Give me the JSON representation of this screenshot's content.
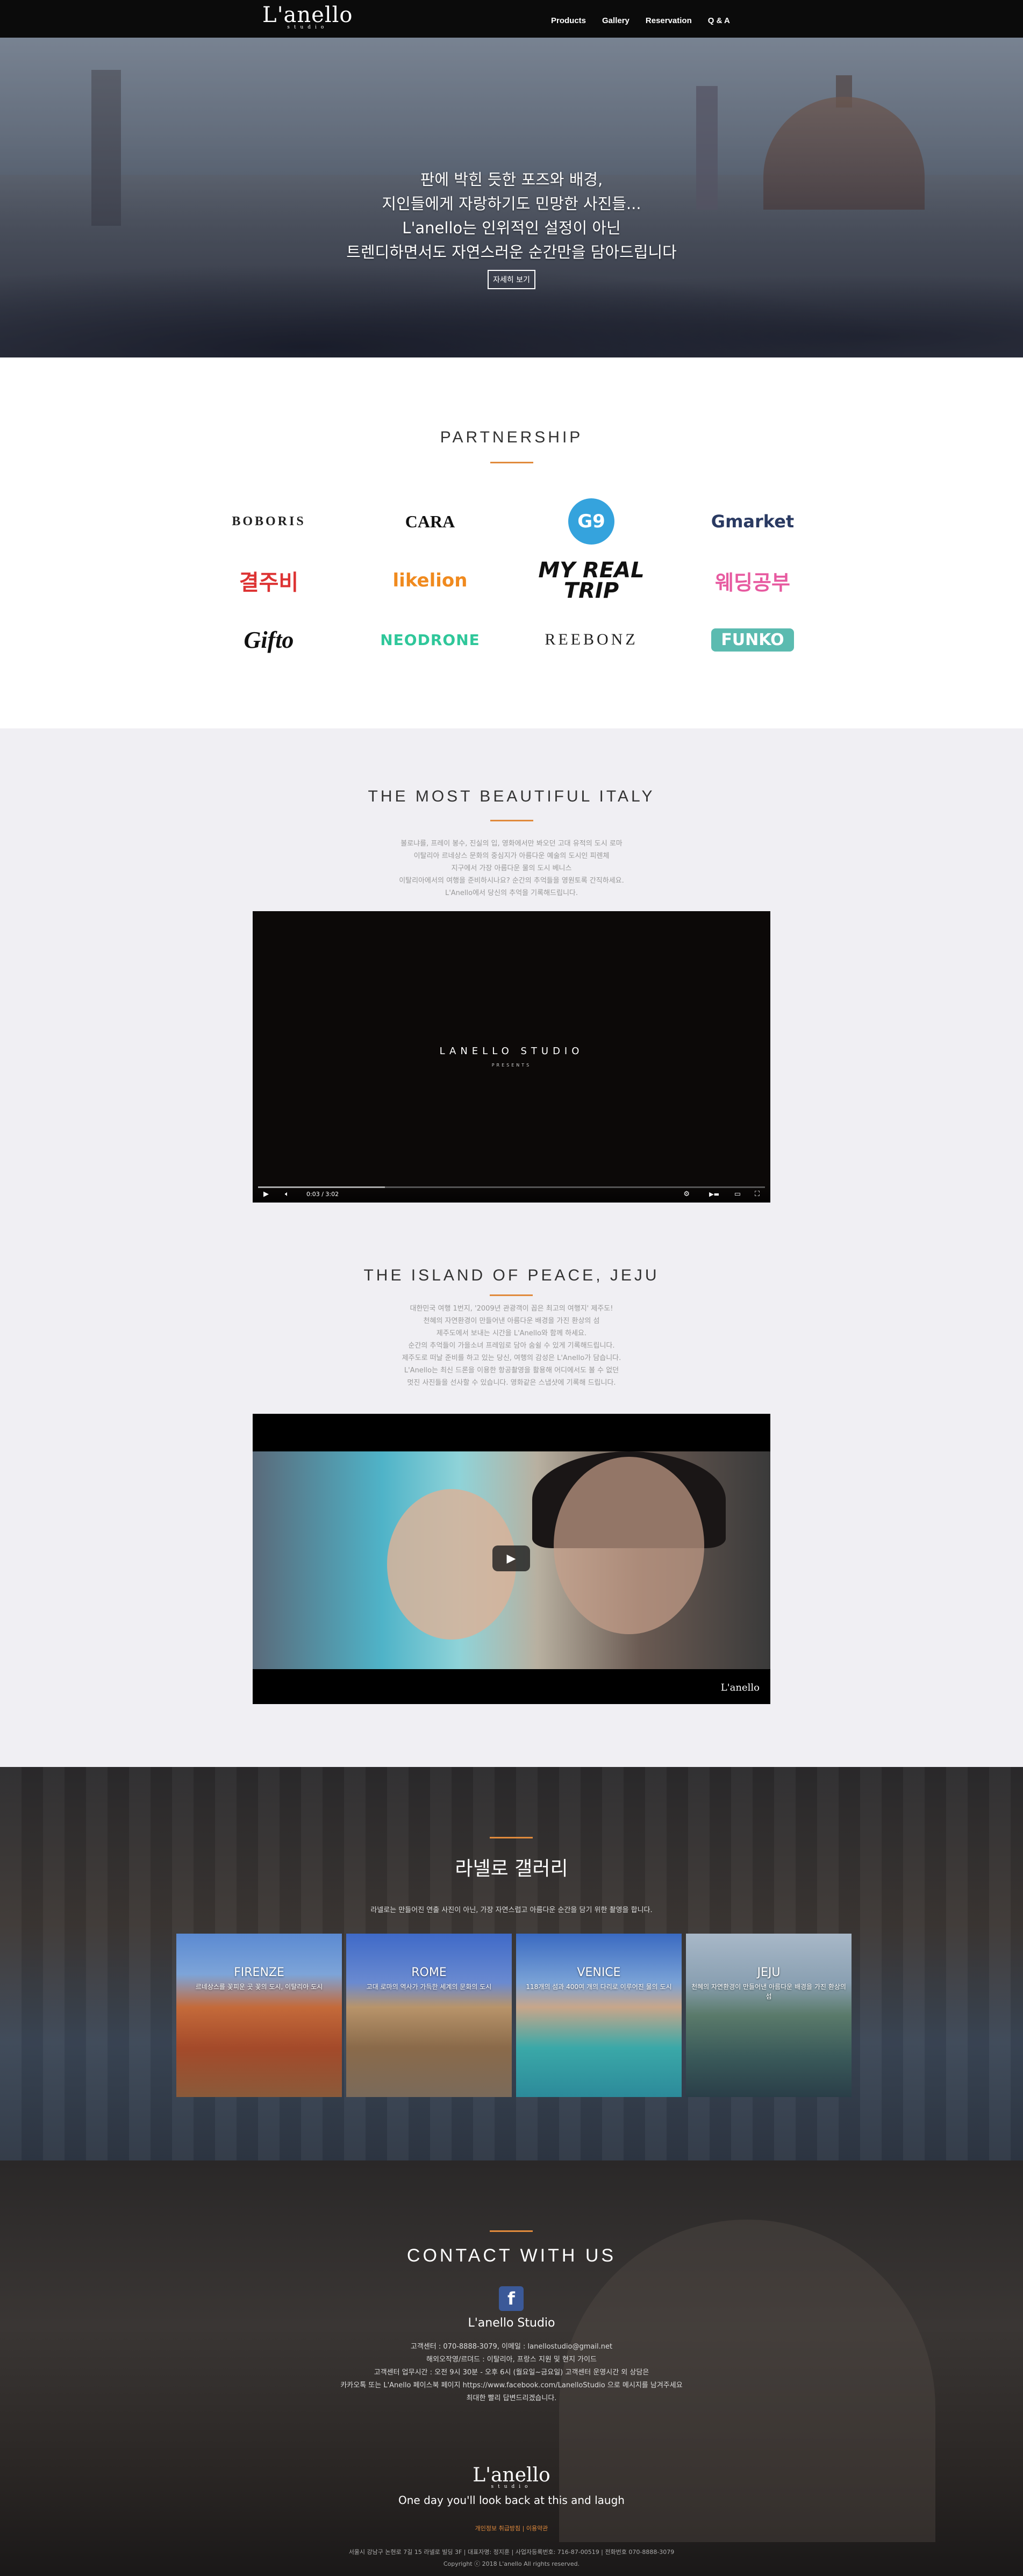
{
  "brand": {
    "logo": "L'anello",
    "sub": "studio"
  },
  "nav": {
    "items": [
      "Products",
      "Gallery",
      "Reservation",
      "Q & A"
    ]
  },
  "hero": {
    "lines": [
      "판에 박힌 듯한 포즈와 배경,",
      "지인들에게 자랑하기도 민망한 사진들...",
      "L'anello는 인위적인 설정이 아닌",
      "트렌디하면서도 자연스러운 순간만을 담아드립니다"
    ],
    "button": "자세히 보기"
  },
  "partnership": {
    "title": "PARTNERSHIP",
    "logos": [
      "BOBORIS",
      "CARA",
      "G9",
      "Gmarket",
      "결주비",
      "likelion",
      "MY REAL TRIP",
      "웨딩공부",
      "Gifto",
      "NEODRONE",
      "REEBONZ",
      "FUNKO"
    ]
  },
  "italy": {
    "title": "THE MOST BEAUTIFUL ITALY",
    "desc": [
      "볼로냐를, 프레이 봉수, 진실의 입, 영화에서만 봐오던 고대 유적의 도시 로마",
      "이탈리아 르네상스 문화의 중심지가 아름다운 예술의 도시인 피렌체",
      "지구에서 가장 아름다운 물의 도시 베니스",
      "이탈리아에서의 여행을 준비하시나요? 순간의 추억들을 영원토록 간직하세요.",
      "L'Anello에서 당신의 추억을 기록해드립니다."
    ],
    "video": {
      "title": "LANELLO STUDIO",
      "subtitle": "PRESENTS",
      "time": "0:03 / 3:02",
      "progress": 0.25
    }
  },
  "jeju": {
    "title": "THE ISLAND OF PEACE, JEJU",
    "desc": [
      "대한민국 여행 1번지, '2009년 관광객이 꼽은 최고의 여행지' 제주도!",
      "천혜의 자연환경이 만들어낸 아름다운 배경을 가진 환상의 섬",
      "제주도에서 보내는 시간을 L'Anello와 함께 하세요.",
      "순간의 추억들이 가을소녀 프레임로 담아 숨쉴 수 있게 기록해드립니다.",
      "제주도로 떠날 준비를 하고 있는 당신, 여행의 감성은 L'Anello가 담습니다.",
      "L'Anello는 최신 드론을 이용한 항공촬영을 활용해 어디에서도 볼 수 없던",
      "멋진 사진들을 선사할 수 있습니다. 영화같은 스냅샷에 기록해 드립니다."
    ],
    "watermark": "L'anello"
  },
  "gallery": {
    "title": "라넬로 갤러리",
    "desc": "라넬로는 만들어진 연출 사진이 아닌, 가장 자연스럽고 아름다운 순간을 담기 위한 촬영을 합니다.",
    "cards": [
      {
        "name": "FIRENZE",
        "sub": "르네상스를 꽃피운 곳 꽃의 도시, 이탈리아 도시"
      },
      {
        "name": "ROME",
        "sub": "고대 로마의 역사가 가득한 세계의 문화의 도시"
      },
      {
        "name": "VENICE",
        "sub": "118개의 섬과 400여 개의 다리로 이루어진 물의 도시"
      },
      {
        "name": "JEJU",
        "sub": "천혜의 자연환경이 만들어낸 아름다운 배경을 가진 환상의 섬"
      }
    ]
  },
  "contact": {
    "title": "CONTACT WITH US",
    "fb_name": "L'anello Studio",
    "info": [
      "고객센터 : 070-8888-3079, 이메일 : lanellostudio@gmail.net",
      "해외오작영/르뎌드 : 이탈리아, 프랑스 지원 및 현지 가이드",
      "고객센터 업무시간 : 오전 9시 30분 - 오후 6시 (월요일~금요일) 고객센터 운영시간 외 상담은",
      "카카오톡 또는 L'Anello 페이스북 페이지 https://www.facebook.com/LanelloStudio 으로 메시지를 남겨주세요",
      "최대한 빨리 답변드리겠습니다."
    ],
    "logo": "L'anello",
    "logo_sub": "studio",
    "slogan": "One day you'll look back at this and laugh",
    "links": "개인정보 취급방침 | 이용약관",
    "address": "서울시 강남구 논현로 7길 15 라넬로 빌딩 3F | 대표자명: 정지훈 | 사업자등록번호: 716-87-00519 | 전화번호 070-8888-3079",
    "copyright": "Copyright ⓒ 2018 L'anello All rights reserved."
  },
  "colors": {
    "accent": "#e08a3c",
    "nav": "#0b0b0b",
    "section_gray": "#f0eff3",
    "facebook": "#3b5998"
  }
}
